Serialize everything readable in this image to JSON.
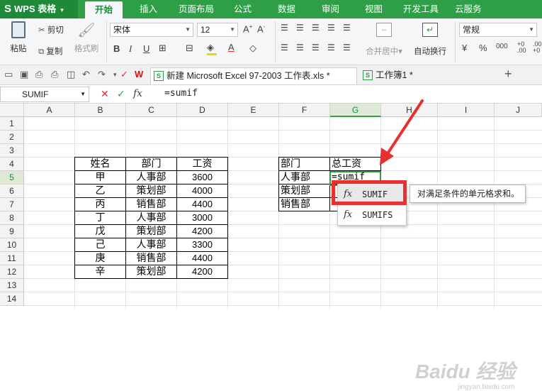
{
  "app": {
    "name": "WPS 表格",
    "logo": "S"
  },
  "menu": {
    "tabs": [
      "开始",
      "插入",
      "页面布局",
      "公式",
      "数据",
      "审阅",
      "视图",
      "开发工具",
      "云服务"
    ],
    "active": "开始"
  },
  "ribbon": {
    "paste": "粘贴",
    "cut": "剪切",
    "copy": "复制",
    "format_painter": "格式刷",
    "font_name": "宋体",
    "font_size": "12",
    "bold": "B",
    "italic": "I",
    "underline": "U",
    "font_color": "A",
    "merge_center": "合并居中",
    "wrap_text": "自动换行",
    "number_format": "常规",
    "percent": "%",
    "thousands": "000"
  },
  "doc_tabs": [
    {
      "label": "新建 Microsoft Excel 97-2003 工作表.xls *",
      "active": true
    },
    {
      "label": "工作簿1 *",
      "active": false
    }
  ],
  "add_tab": "+",
  "formula_bar": {
    "name_box": "SUMIF",
    "fx": "fx",
    "cancel": "✕",
    "confirm": "✓",
    "formula": "=sumif"
  },
  "columns": [
    "A",
    "B",
    "C",
    "D",
    "E",
    "F",
    "G",
    "H",
    "I",
    "J"
  ],
  "rows": [
    "1",
    "2",
    "3",
    "4",
    "5",
    "6",
    "7",
    "8",
    "9",
    "10",
    "11",
    "12",
    "13",
    "14"
  ],
  "table1": {
    "headers": [
      "姓名",
      "部门",
      "工资"
    ],
    "rows": [
      [
        "甲",
        "人事部",
        "3600"
      ],
      [
        "乙",
        "策划部",
        "4000"
      ],
      [
        "丙",
        "销售部",
        "4400"
      ],
      [
        "丁",
        "人事部",
        "3000"
      ],
      [
        "戊",
        "策划部",
        "4200"
      ],
      [
        "己",
        "人事部",
        "3300"
      ],
      [
        "庚",
        "销售部",
        "4400"
      ],
      [
        "辛",
        "策划部",
        "4200"
      ]
    ]
  },
  "table2": {
    "headers": [
      "部门",
      "总工资"
    ],
    "rows": [
      [
        "人事部",
        "=sumif"
      ],
      [
        "策划部",
        ""
      ],
      [
        "销售部",
        ""
      ]
    ]
  },
  "autocomplete": {
    "items": [
      {
        "fx": "fx",
        "label": "SUMIF"
      },
      {
        "fx": "fx",
        "label": "SUMIFS"
      }
    ],
    "tooltip": "对满足条件的单元格求和。"
  },
  "watermark": {
    "text": "Baidu 经验",
    "url": "jingyan.baidu.com"
  },
  "colors": {
    "wps_green": "#2e9f46",
    "highlight_red": "#e8312e"
  }
}
